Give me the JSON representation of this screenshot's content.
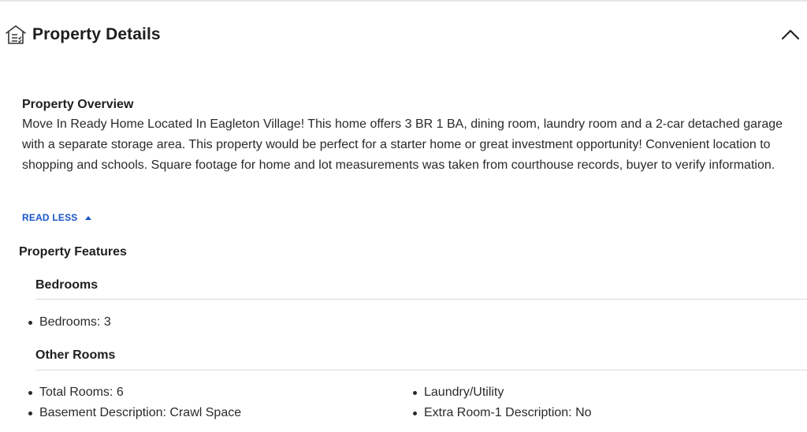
{
  "section": {
    "title": "Property Details",
    "icon": "house-list-icon",
    "collapse_icon": "chevron-up-icon"
  },
  "overview": {
    "heading": "Property Overview",
    "text": "Move In Ready Home Located In Eagleton Village! This home offers 3 BR 1 BA, dining room, laundry room and a 2-car detached garage with a separate storage area. This property would be perfect for a starter home or great investment opportunity! Convenient location to shopping and schools. Square footage for home and lot measurements was taken from courthouse records, buyer to verify information.",
    "toggle_label": "READ LESS",
    "toggle_color": "#1a56c9"
  },
  "features": {
    "heading": "Property Features",
    "groups": [
      {
        "heading": "Bedrooms",
        "items": [
          "Bedrooms: 3"
        ]
      },
      {
        "heading": "Other Rooms",
        "items_left": [
          "Total Rooms: 6",
          "Basement Description: Crawl Space"
        ],
        "items_right": [
          "Laundry/Utility",
          "Extra Room-1 Description: No"
        ]
      }
    ]
  }
}
